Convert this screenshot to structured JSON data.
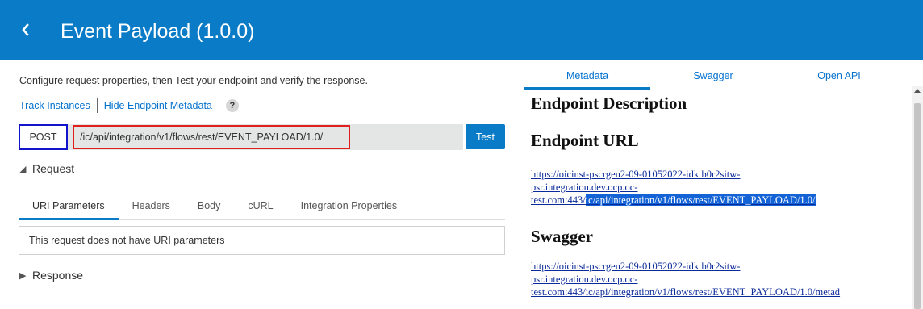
{
  "header": {
    "title": "Event Payload (1.0.0)",
    "back_icon": "chevron-left-icon",
    "color": "#0a7bc6"
  },
  "left": {
    "instructions": "Configure request properties, then Test your endpoint and verify the response.",
    "track_instances": "Track Instances",
    "hide_metadata": "Hide Endpoint Metadata",
    "help_glyph": "?",
    "method": "POST",
    "endpoint_path": "/ic/api/integration/v1/flows/rest/EVENT_PAYLOAD/1.0/",
    "test_label": "Test",
    "request_label": "Request",
    "response_label": "Response",
    "request_tabs": [
      {
        "label": "URI Parameters",
        "active": true
      },
      {
        "label": "Headers",
        "active": false
      },
      {
        "label": "Body",
        "active": false
      },
      {
        "label": "cURL",
        "active": false
      },
      {
        "label": "Integration Properties",
        "active": false
      }
    ],
    "no_params_message": "This request does not have URI parameters"
  },
  "right": {
    "tabs": [
      {
        "label": "Metadata",
        "active": true
      },
      {
        "label": "Swagger",
        "active": false
      },
      {
        "label": "Open API",
        "active": false
      }
    ],
    "endpoint_description_heading": "Endpoint Description",
    "endpoint_url_heading": "Endpoint URL",
    "endpoint_url_line1": "https://oicinst-pscrgen2-09-01052022-idktb0r2sitw-",
    "endpoint_url_line2": "psr.integration.dev.ocp.oc-",
    "endpoint_url_line3_prefix": "test.com:443/",
    "endpoint_url_line3_highlight": "ic/api/integration/v1/flows/rest/EVENT_PAYLOAD/1.0/",
    "swagger_heading": "Swagger",
    "swagger_url_line1": "https://oicinst-pscrgen2-09-01052022-idktb0r2sitw-",
    "swagger_url_line2": "psr.integration.dev.ocp.oc-",
    "swagger_url_line3": "test.com:443/ic/api/integration/v1/flows/rest/EVENT_PAYLOAD/1.0/metad"
  }
}
